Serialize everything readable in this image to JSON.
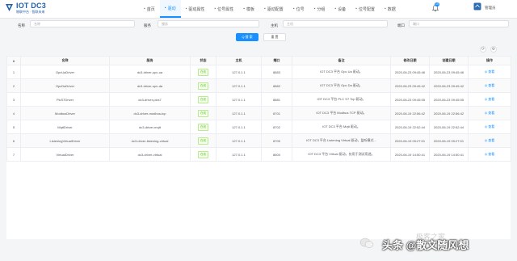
{
  "app": {
    "title": "IOT DC3",
    "subtitle": "物联中台 · 智联未来"
  },
  "nav": [
    {
      "label": "首页",
      "icon": "home-icon"
    },
    {
      "label": "驱动",
      "icon": "driver-icon",
      "active": true
    },
    {
      "label": "驱动属性",
      "icon": "attribute-icon"
    },
    {
      "label": "位号属性",
      "icon": "attribute-icon"
    },
    {
      "label": "模板",
      "icon": "template-icon"
    },
    {
      "label": "驱动配置",
      "icon": "config-icon"
    },
    {
      "label": "位号",
      "icon": "tag-icon"
    },
    {
      "label": "分组",
      "icon": "group-icon"
    },
    {
      "label": "设备",
      "icon": "device-icon"
    },
    {
      "label": "位号配置",
      "icon": "config-icon"
    },
    {
      "label": "数据",
      "icon": "data-icon"
    }
  ],
  "header": {
    "notification_count": "10",
    "user_name": "管理员"
  },
  "search": {
    "name_label": "名称",
    "name_placeholder": "名称",
    "service_label": "服务",
    "service_placeholder": "服务",
    "host_label": "主机",
    "host_placeholder": "主机",
    "port_label": "端口",
    "port_placeholder": "端口",
    "search_button": "Q 搜 索",
    "reset_button": "重 置"
  },
  "table": {
    "columns": [
      "#",
      "名称",
      "服务",
      "状态",
      "主机",
      "端口",
      "备注",
      "修改日期",
      "创建日期",
      "操作"
    ],
    "rows": [
      [
        "1",
        "OpcUaDriver",
        "dc3-driver-opc-ua",
        "在线",
        "127.0.1.1",
        "8883",
        "IOT DC3 平台 Opc Ua 驱动。",
        "2020-06-23 09:45:46",
        "2020-06-23 09:45:46",
        "◎ 查看"
      ],
      [
        "2",
        "OpcDaDriver",
        "dc3-driver-opc-da",
        "在线",
        "127.0.1.1",
        "8882",
        "IOT DC3 平台 Opc Da 驱动。",
        "2020-06-23 09:45:42",
        "2020-06-23 09:45:42",
        "◎ 查看"
      ],
      [
        "3",
        "PlcS7Driver",
        "dc3-driver-plcs7",
        "在线",
        "127.0.1.1",
        "8881",
        "IOT DC3 平台 PLC S7 Tcp 驱动。",
        "2020-06-23 09:45:05",
        "2020-06-23 09:45:05",
        "◎ 查看"
      ],
      [
        "4",
        "ModbusDriver",
        "dc3-driver-modbus-tcp",
        "在线",
        "127.0.1.1",
        "8701",
        "IOT DC3 平台 Modbus TCP 驱动。",
        "2020-06-19 22:56:42",
        "2020-06-19 22:56:42",
        "◎ 查看"
      ],
      [
        "5",
        "MqttDriver",
        "dc3-driver-mqtt",
        "在线",
        "127.0.1.1",
        "8702",
        "IOT DC3 平台 Mqtt 驱动。",
        "2020-06-19 22:52:44",
        "2020-06-19 22:52:44",
        "◎ 查看"
      ],
      [
        "6",
        "ListeningVirtualDriver",
        "dc3-driver-listening-virtual",
        "在线",
        "127.0.1.1",
        "8700",
        "IOT DC3 平台 Listening Virtual 驱动，监听模式...",
        "2020-06-19 09:27:01",
        "2020-06-19 09:27:01",
        "◎ 查看"
      ],
      [
        "7",
        "VirtualDriver",
        "dc3-driver-virtual",
        "在线",
        "127.0.1.1",
        "8600",
        "IOT DC3 平台 Virtual 驱动，仅用于测试用途。",
        "2020-06-19 14:50:41",
        "2020-06-19 14:50:41",
        "◎ 查看"
      ]
    ]
  },
  "watermark": {
    "faint_text": "极客之家",
    "main_text": "头条 @散文随风想"
  },
  "colors": {
    "accent": "#1890ff",
    "online": "#52c41a",
    "brand": "#1e5fa8"
  }
}
